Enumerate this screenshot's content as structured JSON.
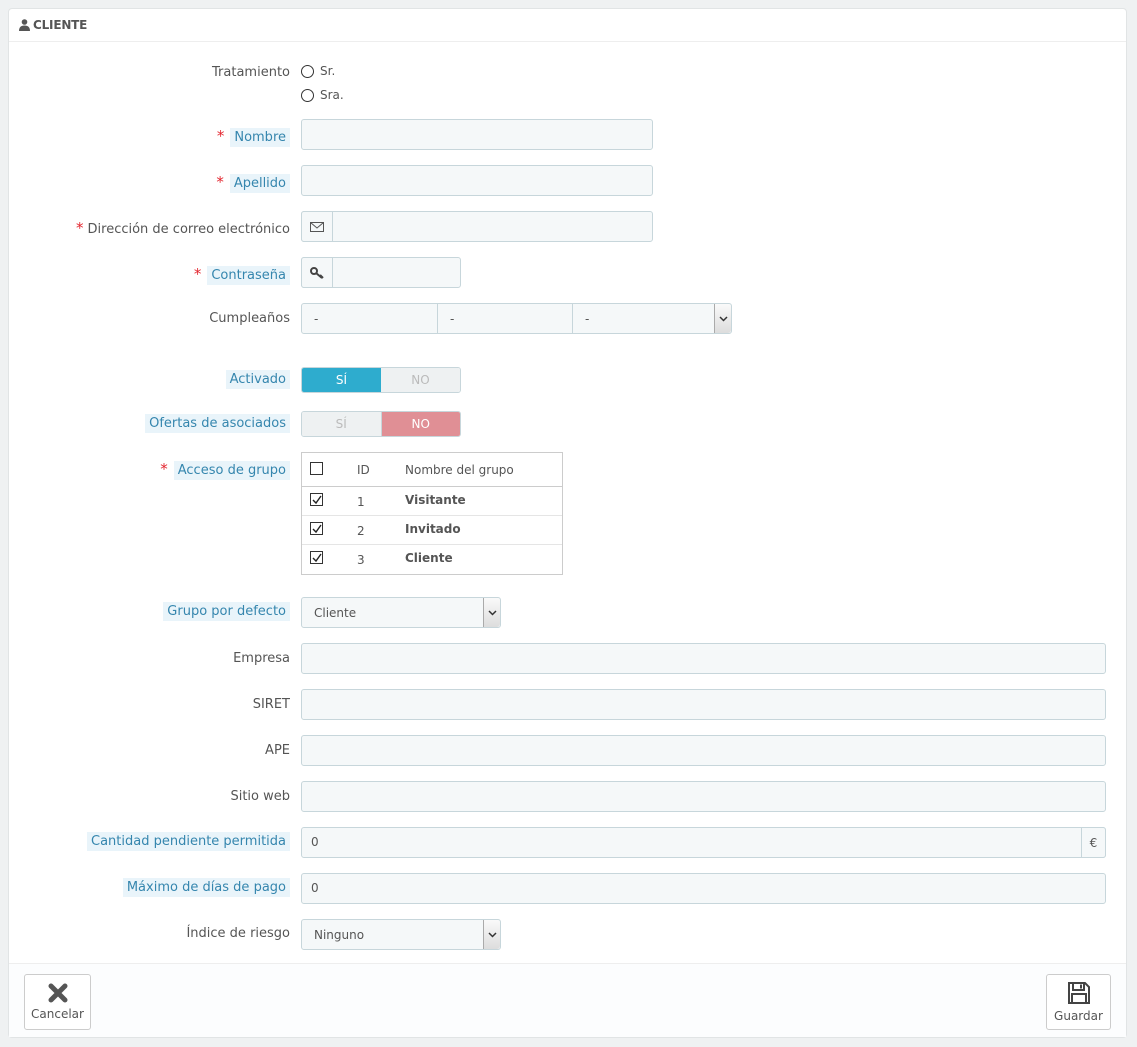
{
  "panel": {
    "title": "CLIENTE"
  },
  "form": {
    "tratamiento": {
      "label": "Tratamiento",
      "options": [
        "Sr.",
        "Sra."
      ]
    },
    "nombre": {
      "label": "Nombre",
      "value": ""
    },
    "apellido": {
      "label": "Apellido",
      "value": ""
    },
    "email": {
      "label": "Dirección de correo electrónico",
      "value": ""
    },
    "password": {
      "label": "Contraseña",
      "value": ""
    },
    "birthday": {
      "label": "Cumpleaños",
      "day": "-",
      "month": "-",
      "year": "-"
    },
    "activado": {
      "label": "Activado",
      "yes": "SÍ",
      "no": "NO",
      "selected": "yes"
    },
    "ofertas": {
      "label": "Ofertas de asociados",
      "yes": "SÍ",
      "no": "NO",
      "selected": "no"
    },
    "grupo": {
      "label": "Acceso de grupo",
      "headers": {
        "id": "ID",
        "name": "Nombre del grupo"
      },
      "rows": [
        {
          "id": "1",
          "name": "Visitante",
          "checked": true
        },
        {
          "id": "2",
          "name": "Invitado",
          "checked": true
        },
        {
          "id": "3",
          "name": "Cliente",
          "checked": true
        }
      ]
    },
    "grupo_defecto": {
      "label": "Grupo por defecto",
      "value": "Cliente"
    },
    "empresa": {
      "label": "Empresa",
      "value": ""
    },
    "siret": {
      "label": "SIRET",
      "value": ""
    },
    "ape": {
      "label": "APE",
      "value": ""
    },
    "web": {
      "label": "Sitio web",
      "value": ""
    },
    "cantidad": {
      "label": "Cantidad pendiente permitida",
      "value": "0",
      "currency": "€"
    },
    "dias": {
      "label": "Máximo de días de pago",
      "value": "0"
    },
    "riesgo": {
      "label": "Índice de riesgo",
      "value": "Ninguno"
    }
  },
  "footer": {
    "cancel": "Cancelar",
    "save": "Guardar"
  },
  "colors": {
    "accent": "#2eacce",
    "danger": "#e08f95",
    "hint_bg": "#e9f4fa",
    "hint_text": "#3586ae",
    "required": "#e3262f"
  }
}
